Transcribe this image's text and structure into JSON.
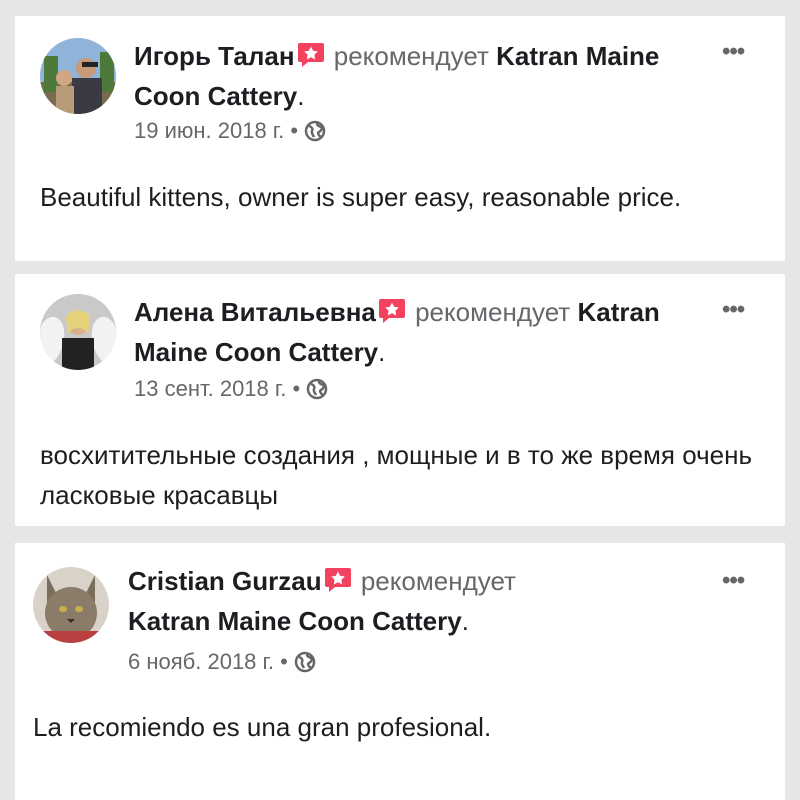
{
  "colors": {
    "background": "#e6e6e6",
    "card": "#ffffff",
    "text": "#1c1e21",
    "muted": "#65676b",
    "badge": "#f3425f"
  },
  "reviews": [
    {
      "author": "Игорь Талан",
      "verb": "рекомендует",
      "page": "Katran Maine Coon Cattery",
      "period": ".",
      "date": "19 июн. 2018 г.",
      "separator": "•",
      "audience_icon": "globe-icon",
      "more": "•••",
      "text": "Beautiful kittens, owner is super easy, reasonable price."
    },
    {
      "author": "Алена Витальевна",
      "verb": "рекомендует",
      "page": "Katran Maine Coon Cattery",
      "period": ".",
      "date": "13 сент. 2018 г.",
      "separator": "•",
      "audience_icon": "globe-icon",
      "more": "•••",
      "text": "восхитительные создания , мощные и в то же время очень ласковые красавцы"
    },
    {
      "author": "Cristian Gurzau",
      "verb": "рекомендует",
      "page": "Katran Maine Coon Cattery",
      "period": ".",
      "date": "6 нояб. 2018 г.",
      "separator": "•",
      "audience_icon": "globe-icon",
      "more": "•••",
      "text": "La recomiendo es una gran profesional."
    }
  ]
}
